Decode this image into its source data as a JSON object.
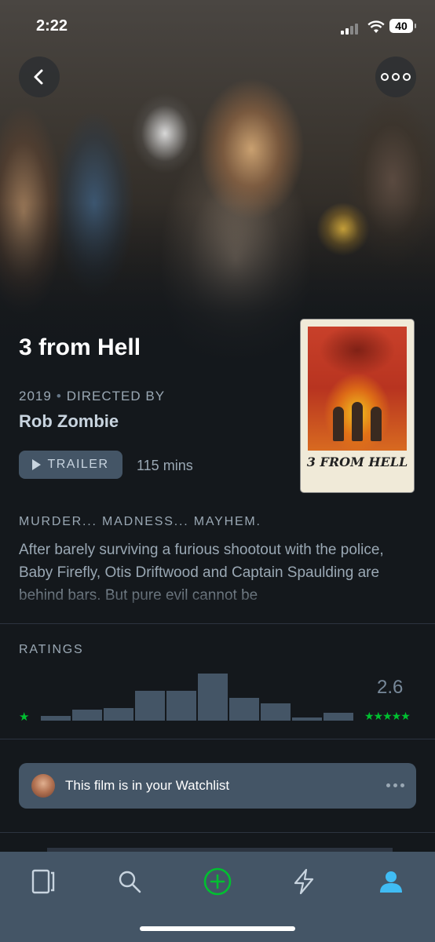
{
  "status_bar": {
    "time": "2:22",
    "battery": "40"
  },
  "header": {
    "back_icon": "chevron-left-icon",
    "more_icon": "ellipsis-icon"
  },
  "film": {
    "title": "3 from Hell",
    "year": "2019",
    "directed_by_label": "DIRECTED BY",
    "director": "Rob Zombie",
    "trailer_label": "TRAILER",
    "runtime": "115 mins",
    "poster_title": "3 FROM HELL",
    "tagline": "MURDER... MADNESS... MAYHEM.",
    "synopsis": "After barely surviving a furious shootout with the police, Baby Firefly, Otis Driftwood and Captain Spaulding are behind bars. But pure evil cannot be"
  },
  "ratings": {
    "label": "RATINGS",
    "average": "2.6",
    "low_star": "★",
    "high_stars": "★★★★★",
    "histogram": [
      0.1,
      0.23,
      0.26,
      0.63,
      0.63,
      1.0,
      0.48,
      0.36,
      0.06,
      0.16
    ]
  },
  "watchlist": {
    "text": "This film is in your Watchlist"
  },
  "tabbar": {
    "items": [
      {
        "name": "films",
        "icon": "film-icon"
      },
      {
        "name": "search",
        "icon": "search-icon"
      },
      {
        "name": "add",
        "icon": "plus-circle-icon"
      },
      {
        "name": "activity",
        "icon": "lightning-icon"
      },
      {
        "name": "profile",
        "icon": "person-icon"
      }
    ]
  },
  "colors": {
    "accent_green": "#00c030",
    "active_blue": "#40bcf4",
    "card": "#445566",
    "bg": "#14181c"
  }
}
